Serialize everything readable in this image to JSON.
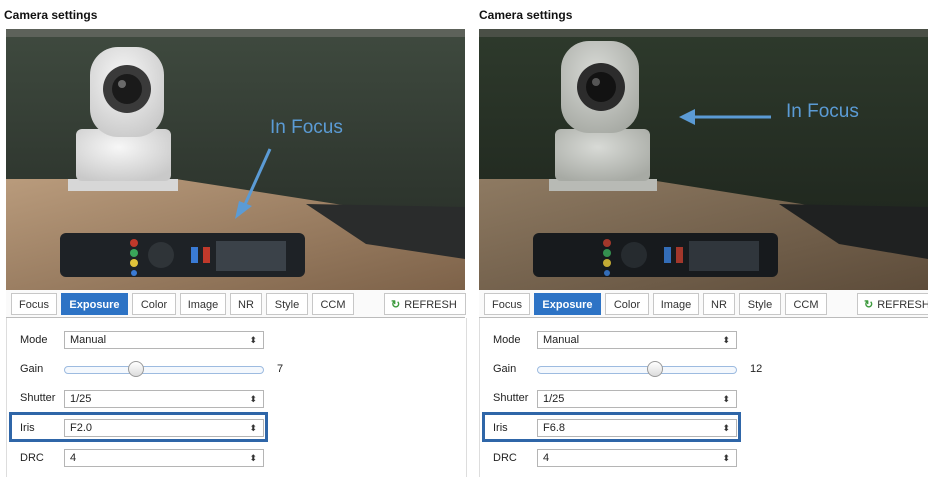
{
  "panels": [
    {
      "title": "Camera settings",
      "annotation": "In Focus",
      "tabs": [
        "Focus",
        "Exposure",
        "Color",
        "Image",
        "NR",
        "Style",
        "CCM"
      ],
      "active_tab": "Exposure",
      "refresh_label": "REFRESH",
      "fields": {
        "mode_label": "Mode",
        "mode_value": "Manual",
        "gain_label": "Gain",
        "gain_value": "7",
        "gain_level": 0.35,
        "shutter_label": "Shutter",
        "shutter_value": "1/25",
        "iris_label": "Iris",
        "iris_value": "F2.0",
        "drc_label": "DRC",
        "drc_value": "4"
      }
    },
    {
      "title": "Camera settings",
      "annotation": "In Focus",
      "tabs": [
        "Focus",
        "Exposure",
        "Color",
        "Image",
        "NR",
        "Style",
        "CCM"
      ],
      "active_tab": "Exposure",
      "refresh_label": "REFRESH",
      "fields": {
        "mode_label": "Mode",
        "mode_value": "Manual",
        "gain_label": "Gain",
        "gain_value": "12",
        "gain_level": 0.6,
        "shutter_label": "Shutter",
        "shutter_value": "1/25",
        "iris_label": "Iris",
        "iris_value": "F6.8",
        "drc_label": "DRC",
        "drc_value": "4"
      }
    }
  ],
  "colors": {
    "accent": "#2d73c5",
    "highlight_box": "#2f66a8",
    "annotation_text": "#5b9bd5",
    "refresh_icon": "#3d9a3d"
  },
  "icons": {
    "select_arrows": "⬍",
    "refresh": "refresh-icon"
  }
}
